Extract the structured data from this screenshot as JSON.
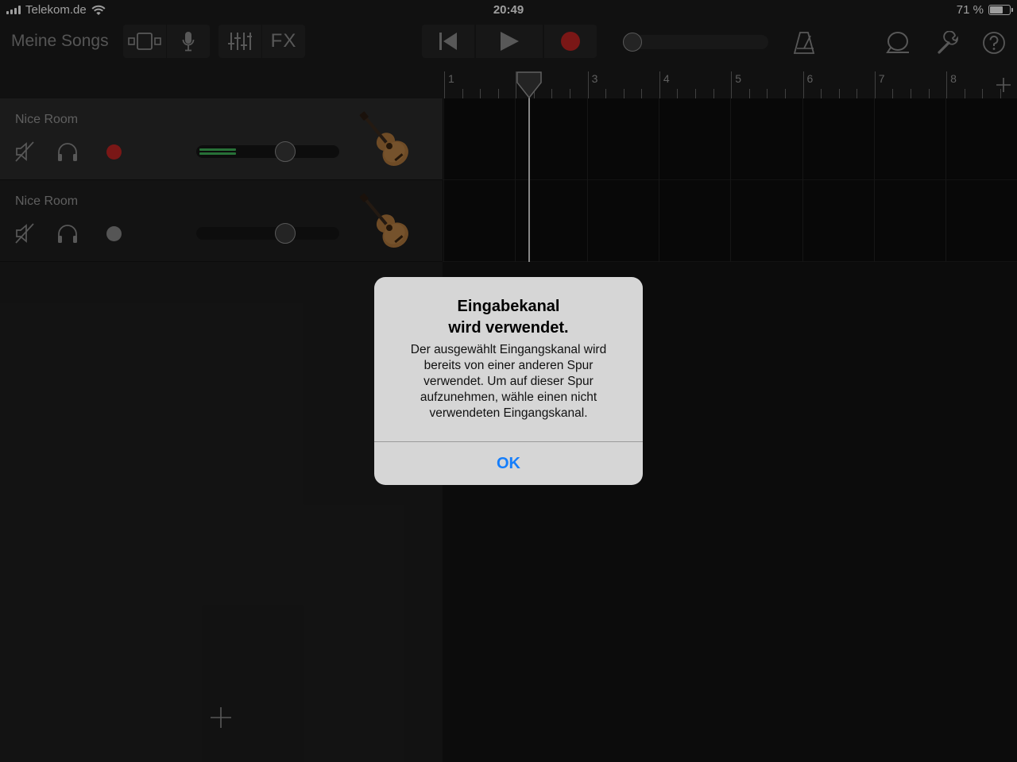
{
  "status_bar": {
    "carrier": "Telekom.de",
    "time": "20:49",
    "battery_text": "71 %",
    "battery_level": 0.71
  },
  "toolbar": {
    "my_songs_label": "Meine Songs",
    "fx_label": "FX",
    "icons": {
      "browser": "track-browser-icon",
      "mic": "microphone-icon",
      "mixer": "mixer-sliders-icon",
      "rewind": "go-to-start-icon",
      "play": "play-icon",
      "record": "record-icon",
      "metronome": "metronome-icon",
      "loop": "loop-browser-icon",
      "settings": "wrench-icon",
      "help": "help-icon"
    }
  },
  "ruler": {
    "bars": [
      "1",
      "2",
      "3",
      "4",
      "5",
      "6",
      "7",
      "8"
    ],
    "playhead_bar": 2.18
  },
  "tracks": [
    {
      "name": "Nice Room",
      "selected": true,
      "record_armed": true,
      "volume_level": 0.62,
      "meter_level": 0.27
    },
    {
      "name": "Nice Room",
      "selected": false,
      "record_armed": false,
      "volume_level": 0.62,
      "meter_level": 0
    }
  ],
  "alert": {
    "title_line1": "Eingabekanal",
    "title_line2": "wird verwendet.",
    "message": "Der ausgewählt Eingangskanal wird bereits von einer anderen Spur verwendet. Um auf dieser Spur aufzunehmen, wähle einen nicht verwendeten Eingangskanal.",
    "ok_label": "OK"
  },
  "colors": {
    "record_red": "#c52624",
    "meter_green": "#3fb55a",
    "alert_button_blue": "#157efb"
  }
}
